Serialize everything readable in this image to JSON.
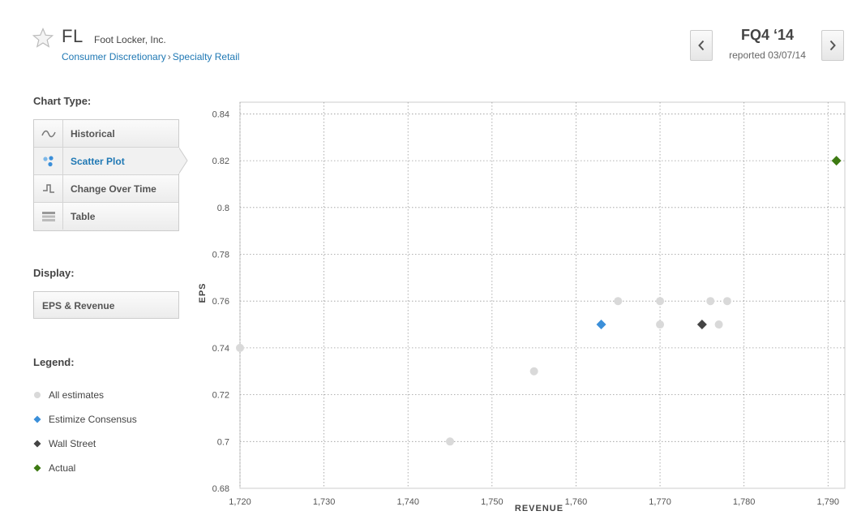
{
  "header": {
    "ticker": "FL",
    "company": "Foot Locker, Inc.",
    "sector": "Consumer Discretionary",
    "breadcrumb_sep": "›",
    "industry": "Specialty Retail",
    "period": "FQ4 ‘14",
    "reported": "reported 03/07/14",
    "prev_icon": "chevron-left-icon",
    "next_icon": "chevron-right-icon",
    "favorite_icon": "star-icon"
  },
  "sidebar": {
    "chart_type_label": "Chart Type:",
    "chart_types": [
      {
        "label": "Historical",
        "icon": "wave-icon",
        "active": false
      },
      {
        "label": "Scatter Plot",
        "icon": "scatter-icon",
        "active": true
      },
      {
        "label": "Change Over Time",
        "icon": "step-icon",
        "active": false
      },
      {
        "label": "Table",
        "icon": "table-icon",
        "active": false
      }
    ],
    "display_label": "Display:",
    "display_value": "EPS & Revenue",
    "legend_label": "Legend:",
    "legend": [
      {
        "label": "All estimates",
        "color": "#d9d9d9",
        "shape": "circle"
      },
      {
        "label": "Estimize Consensus",
        "color": "#3b8fd9",
        "shape": "diamond"
      },
      {
        "label": "Wall Street",
        "color": "#444444",
        "shape": "diamond"
      },
      {
        "label": "Actual",
        "color": "#3d7a12",
        "shape": "diamond"
      }
    ]
  },
  "chart_data": {
    "type": "scatter",
    "xlabel": "REVENUE",
    "ylabel": "EPS",
    "xlim": [
      1720,
      1792
    ],
    "ylim": [
      0.68,
      0.845
    ],
    "x_ticks": [
      1720,
      1730,
      1740,
      1750,
      1760,
      1770,
      1780,
      1790
    ],
    "x_tick_labels": [
      "1,720",
      "1,730",
      "1,740",
      "1,750",
      "1,760",
      "1,770",
      "1,780",
      "1,790"
    ],
    "y_ticks": [
      0.68,
      0.7,
      0.72,
      0.74,
      0.76,
      0.78,
      0.8,
      0.82,
      0.84
    ],
    "y_tick_labels": [
      "0.68",
      "0.7",
      "0.72",
      "0.74",
      "0.76",
      "0.78",
      "0.8",
      "0.82",
      "0.84"
    ],
    "grid": true,
    "series": [
      {
        "name": "All estimates",
        "color": "#d9d9d9",
        "shape": "circle",
        "points": [
          [
            1720,
            0.74
          ],
          [
            1745,
            0.7
          ],
          [
            1755,
            0.73
          ],
          [
            1765,
            0.76
          ],
          [
            1770,
            0.76
          ],
          [
            1770,
            0.75
          ],
          [
            1776,
            0.76
          ],
          [
            1777,
            0.75
          ],
          [
            1778,
            0.76
          ]
        ]
      },
      {
        "name": "Estimize Consensus",
        "color": "#3b8fd9",
        "shape": "diamond",
        "points": [
          [
            1763,
            0.75
          ]
        ]
      },
      {
        "name": "Wall Street",
        "color": "#444444",
        "shape": "diamond",
        "points": [
          [
            1775,
            0.75
          ]
        ]
      },
      {
        "name": "Actual",
        "color": "#3d7a12",
        "shape": "diamond",
        "points": [
          [
            1791,
            0.82
          ]
        ]
      }
    ]
  }
}
